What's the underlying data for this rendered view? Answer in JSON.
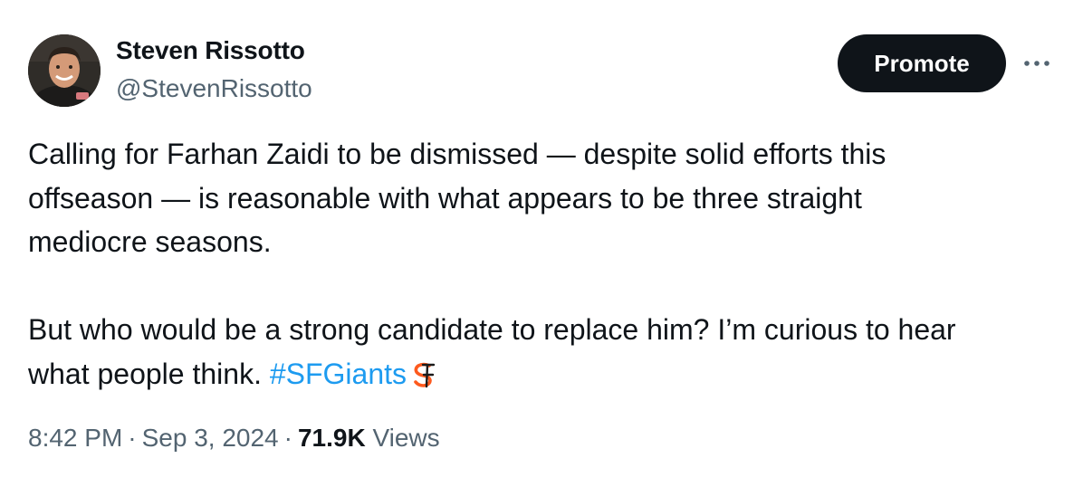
{
  "author": {
    "display_name": "Steven Rissotto",
    "handle": "@StevenRissotto"
  },
  "actions": {
    "promote_label": "Promote",
    "more_icon": "more-horizontal-icon"
  },
  "tweet": {
    "paragraph_1_line_1": "Calling for Farhan Zaidi to be dismissed — despite solid efforts this",
    "paragraph_1_line_2": "offseason —  is reasonable with what appears to be three straight",
    "paragraph_1_line_3": "mediocre seasons.",
    "paragraph_2_line_1": "But who would be a strong candidate to replace him?  I’m curious to hear",
    "paragraph_2_line_2_text": "what people think. ",
    "hashtag": "#SFGiants",
    "hashtag_icon": "sf-giants-logo-icon"
  },
  "meta": {
    "time": "8:42 PM",
    "separator": "·",
    "date": "Sep 3, 2024",
    "views_count": "71.9K",
    "views_label": "Views"
  },
  "colors": {
    "text": "#0f1419",
    "secondary": "#536471",
    "link": "#1d9bf0",
    "button_bg": "#0f1419",
    "giants_orange": "#fd5a1e"
  }
}
